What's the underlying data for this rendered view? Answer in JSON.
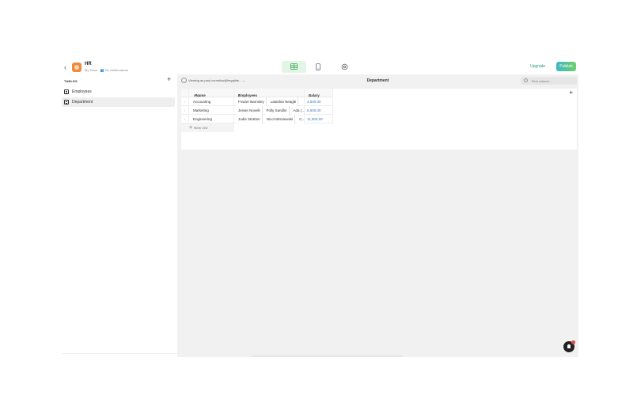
{
  "header": {
    "app_title": "HR",
    "app_subtitle": "My Team · 👥 No collaborators",
    "upgrade_label": "Upgrade",
    "publish_label": "Publish"
  },
  "sidebar": {
    "tables_label": "TABLES",
    "items": [
      {
        "label": "Employees",
        "selected": false
      },
      {
        "label": "Department",
        "selected": true
      }
    ]
  },
  "toolbar": {
    "viewing_text": "Viewing as paul.cornelius@heyglide...",
    "view_title": "Department",
    "find_placeholder": "Find column..."
  },
  "table": {
    "columns": [
      "Name",
      "Employees",
      "Salary"
    ],
    "rows": [
      {
        "name": "Accounting",
        "employees": [
          "Frazier Barnsley",
          "Latashia Neagle"
        ],
        "salary": "4,500.00"
      },
      {
        "name": "Marketing",
        "employees": [
          "Jessie Novelli",
          "Polly Sandlin",
          "Ada (…"
        ],
        "salary": "6,500.00"
      },
      {
        "name": "Engineering",
        "employees": [
          "Jodie Stratton",
          "Nicol Wisniewski",
          "C…"
        ],
        "salary": "11,900.00"
      }
    ],
    "new_row_label": "New row"
  },
  "colors": {
    "accent": "#2b9e72",
    "active_view_bg": "#e3f5e5",
    "salary_text": "#3a7bbf"
  }
}
